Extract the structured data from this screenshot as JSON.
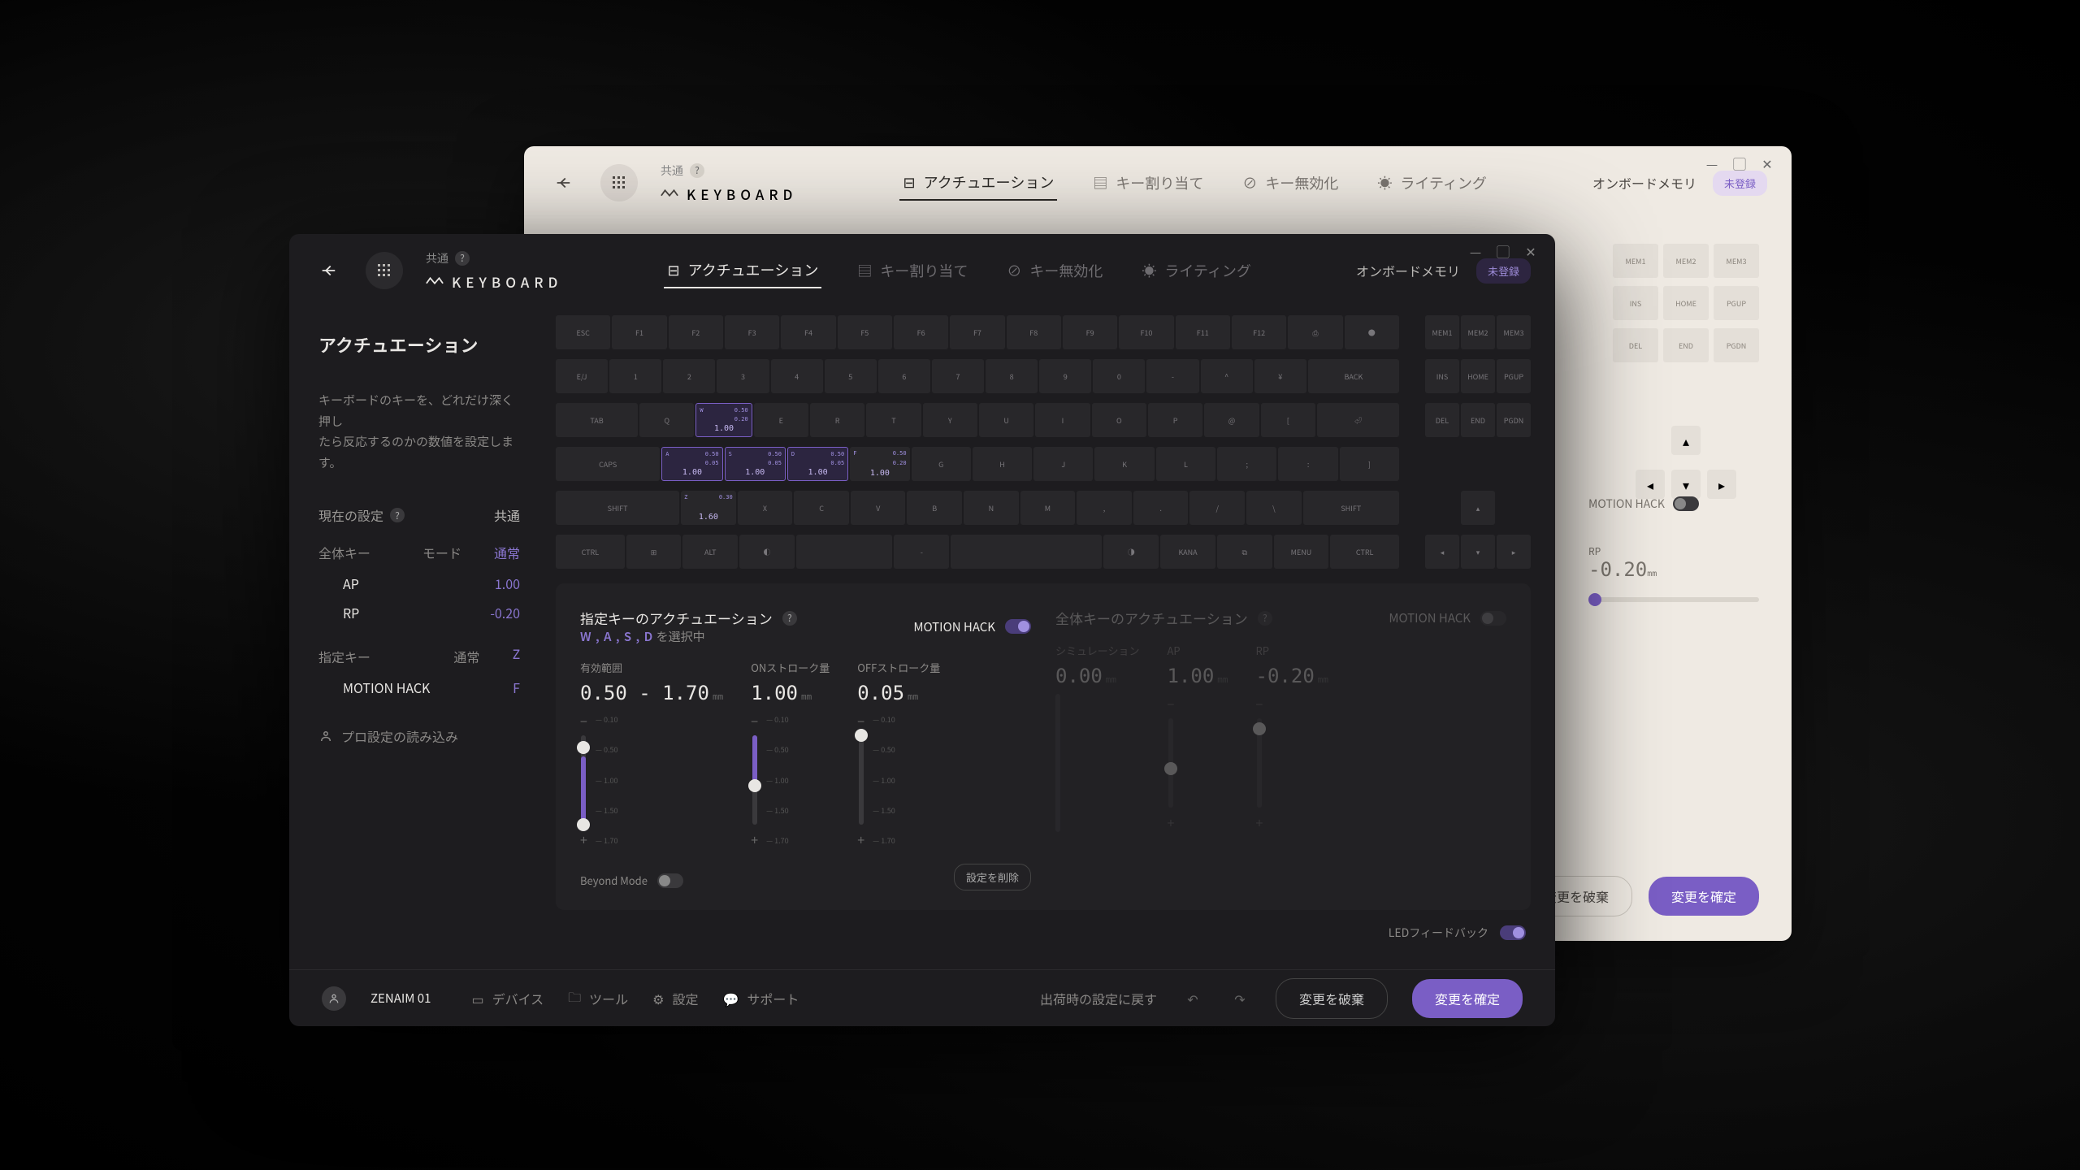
{
  "brand": {
    "top_label": "共通",
    "name": "KEYBOARD"
  },
  "tabs": {
    "actuation": "アクチュエーション",
    "keymap": "キー割り当て",
    "disable": "キー無効化",
    "lighting": "ライティング"
  },
  "memory": {
    "label": "オンボードメモリ",
    "badge": "未登録"
  },
  "sidebar": {
    "title": "アクチュエーション",
    "desc1": "キーボードのキーを、どれだけ深く押し",
    "desc2": "たら反応するのかの数値を設定します。",
    "current_settings": "現在の設定",
    "common": "共通",
    "global_key": "全体キー",
    "mode_label": "モード",
    "mode_value": "通常",
    "ap_label": "AP",
    "ap_value": "1.00",
    "rp_label": "RP",
    "rp_value": "-0.20",
    "selected_key": "指定キー",
    "normal_label": "通常",
    "normal_value": "Z",
    "mh_label": "MOTION HACK",
    "mh_value": "F",
    "load_pro": "プロ設定の読み込み"
  },
  "keyboard": {
    "row_f": [
      "ESC",
      "F1",
      "F2",
      "F3",
      "F4",
      "F5",
      "F6",
      "F7",
      "F8",
      "F9",
      "F10",
      "F11",
      "F12",
      "⎙",
      "●"
    ],
    "row_num": [
      "E/J",
      "1",
      "2",
      "3",
      "4",
      "5",
      "6",
      "7",
      "8",
      "9",
      "0",
      "-",
      "^",
      "¥",
      "BACK"
    ],
    "row_q": [
      "TAB",
      "Q",
      "W",
      "E",
      "R",
      "T",
      "Y",
      "U",
      "I",
      "O",
      "P",
      "@",
      "[",
      "⏎"
    ],
    "row_a": [
      "CAPS",
      "A",
      "S",
      "D",
      "F",
      "G",
      "H",
      "J",
      "K",
      "L",
      ";",
      ":",
      "]"
    ],
    "row_z": [
      "SHIFT",
      "Z",
      "X",
      "C",
      "V",
      "B",
      "N",
      "M",
      ",",
      ".",
      "/",
      "\\",
      "SHIFT"
    ],
    "row_sp": [
      "CTRL",
      "⊞",
      "ALT",
      "◐",
      "",
      "-",
      "",
      "◑",
      "KANA",
      "⧉",
      "MENU",
      "CTRL"
    ],
    "nav1": [
      "INS",
      "HOME",
      "PGUP"
    ],
    "nav2": [
      "DEL",
      "END",
      "PGDN"
    ],
    "mem_row": [
      "MEM1",
      "MEM2",
      "MEM3"
    ],
    "tune_w": {
      "a": "0.50",
      "b": "0.20",
      "c": "1.00"
    },
    "tune_a": {
      "a": "0.50",
      "b": "0.05",
      "c": "1.00"
    },
    "tune_s": {
      "a": "0.50",
      "b": "0.05",
      "c": "1.00"
    },
    "tune_d": {
      "a": "0.50",
      "b": "0.05",
      "c": "1.00"
    },
    "tune_f": {
      "a": "0.50",
      "b": "0.20",
      "c": "1.00"
    },
    "tune_z": {
      "a": "0.30",
      "c": "1.60"
    }
  },
  "panel_left": {
    "title": "指定キーのアクチュエーション",
    "selecting_keys": "W , A , S , D",
    "selecting_suffix": "を選択中",
    "mh_label": "MOTION HACK",
    "range_label": "有効範囲",
    "range_value": "0.50 - 1.70",
    "on_label": "ONストローク量",
    "on_value": "1.00",
    "off_label": "OFFストローク量",
    "off_value": "0.05",
    "unit": "mm",
    "beyond": "Beyond Mode",
    "ticks": [
      "0.10",
      "0.50",
      "1.00",
      "1.50",
      "1.70"
    ],
    "clear": "設定を削除"
  },
  "panel_right": {
    "title": "全体キーのアクチュエーション",
    "mh_label": "MOTION HACK",
    "sim_label": "シミュレーション",
    "sim_value": "0.00",
    "ap_label": "AP",
    "ap_value": "1.00",
    "rp_label": "RP",
    "rp_value": "-0.20",
    "unit": "mm"
  },
  "led": {
    "label": "LEDフィードバック"
  },
  "footer": {
    "device": "ZENAIM 01",
    "device_link": "デバイス",
    "tool_link": "ツール",
    "settings_link": "設定",
    "support_link": "サポート",
    "factory_reset": "出荷時の設定に戻す",
    "discard": "変更を破棄",
    "apply": "変更を確定"
  },
  "light": {
    "led": "LEDフィードバック",
    "discard": "変更を破棄",
    "apply": "変更を確定",
    "mh": "MOTION HACK",
    "rp": "RP",
    "rp_val": "-0.20"
  }
}
